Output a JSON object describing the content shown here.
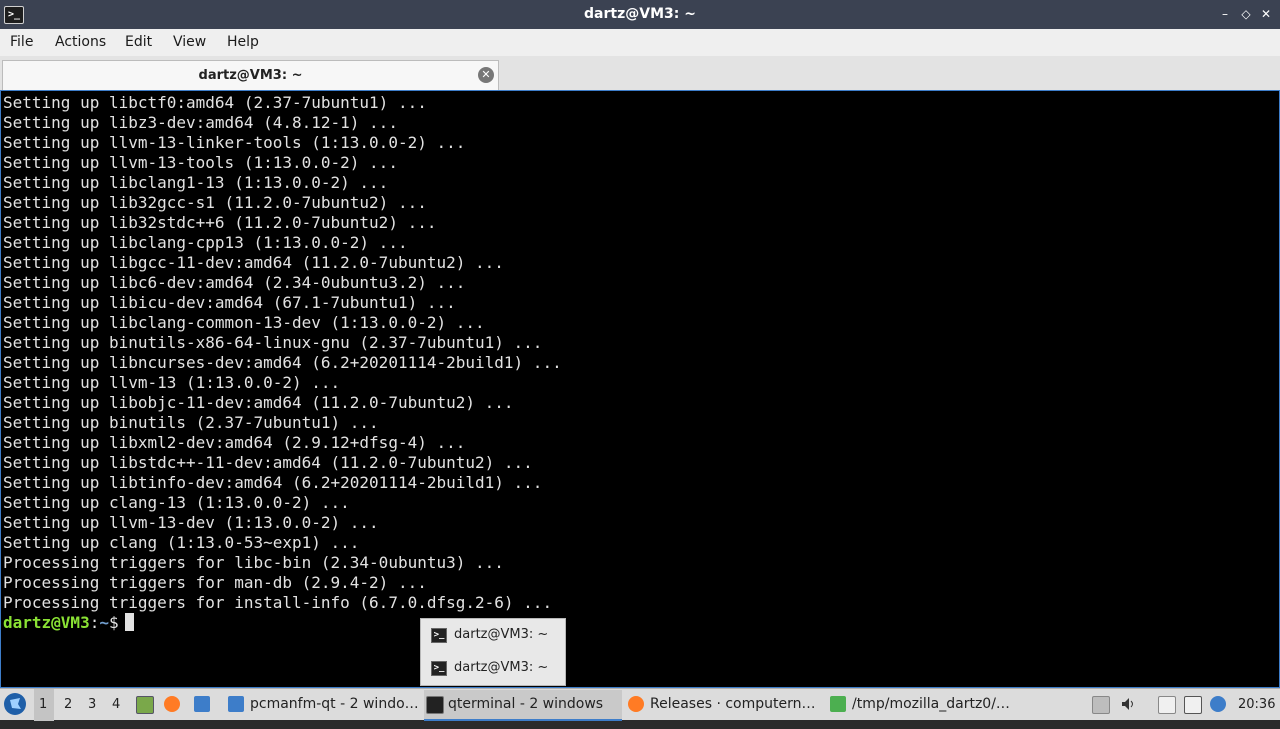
{
  "window": {
    "title": "dartz@VM3: ~",
    "icon_glyph": ">_",
    "minimize": "–",
    "maximize": "◇",
    "close": "✕"
  },
  "menu": {
    "items": [
      "File",
      "Actions",
      "Edit",
      "View",
      "Help"
    ]
  },
  "tabs": [
    {
      "label": "dartz@VM3: ~",
      "close_glyph": "✕"
    }
  ],
  "terminal": {
    "lines": [
      "Setting up libctf0:amd64 (2.37-7ubuntu1) ...",
      "Setting up libz3-dev:amd64 (4.8.12-1) ...",
      "Setting up llvm-13-linker-tools (1:13.0.0-2) ...",
      "Setting up llvm-13-tools (1:13.0.0-2) ...",
      "Setting up libclang1-13 (1:13.0.0-2) ...",
      "Setting up lib32gcc-s1 (11.2.0-7ubuntu2) ...",
      "Setting up lib32stdc++6 (11.2.0-7ubuntu2) ...",
      "Setting up libclang-cpp13 (1:13.0.0-2) ...",
      "Setting up libgcc-11-dev:amd64 (11.2.0-7ubuntu2) ...",
      "Setting up libc6-dev:amd64 (2.34-0ubuntu3.2) ...",
      "Setting up libicu-dev:amd64 (67.1-7ubuntu1) ...",
      "Setting up libclang-common-13-dev (1:13.0.0-2) ...",
      "Setting up binutils-x86-64-linux-gnu (2.37-7ubuntu1) ...",
      "Setting up libncurses-dev:amd64 (6.2+20201114-2build1) ...",
      "Setting up llvm-13 (1:13.0.0-2) ...",
      "Setting up libobjc-11-dev:amd64 (11.2.0-7ubuntu2) ...",
      "Setting up binutils (2.37-7ubuntu1) ...",
      "Setting up libxml2-dev:amd64 (2.9.12+dfsg-4) ...",
      "Setting up libstdc++-11-dev:amd64 (11.2.0-7ubuntu2) ...",
      "Setting up libtinfo-dev:amd64 (6.2+20201114-2build1) ...",
      "Setting up clang-13 (1:13.0.0-2) ...",
      "Setting up llvm-13-dev (1:13.0.0-2) ...",
      "Setting up clang (1:13.0-53~exp1) ...",
      "Processing triggers for libc-bin (2.34-0ubuntu3) ...",
      "Processing triggers for man-db (2.9.4-2) ...",
      "Processing triggers for install-info (6.7.0.dfsg.2-6) ..."
    ],
    "prompt": {
      "user_host": "dartz@VM3",
      "sep": ":",
      "path": "~",
      "symbol": "$"
    }
  },
  "popup": {
    "items": [
      "dartz@VM3: ~",
      "dartz@VM3: ~"
    ]
  },
  "taskbar": {
    "workspaces": [
      "1",
      "2",
      "3",
      "4"
    ],
    "tasks": [
      "pcmanfm-qt - 2 windo…",
      "qterminal - 2 windows",
      "Releases · computern…",
      "/tmp/mozilla_dartz0/…"
    ],
    "clock": "20:36"
  },
  "colors": {
    "accent": "#3d7dc9",
    "prompt_user": "#8ae234",
    "prompt_path": "#729fcf",
    "terminal_bg": "#000000"
  }
}
